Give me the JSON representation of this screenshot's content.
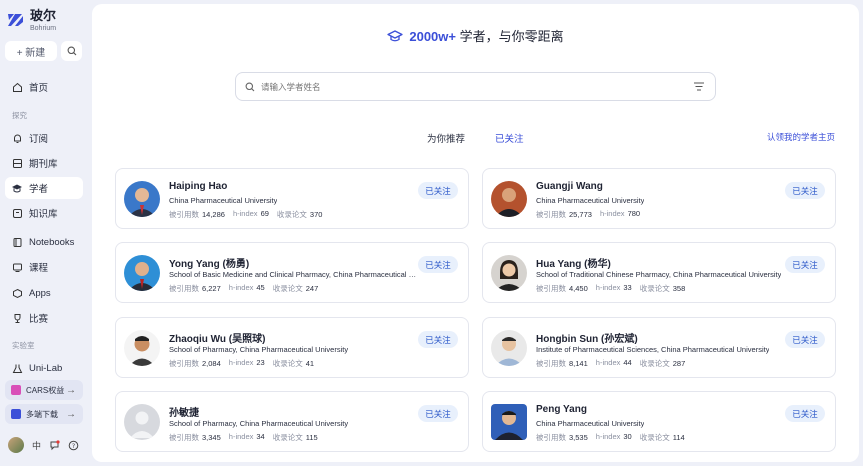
{
  "brand": {
    "name_cn": "玻尔",
    "name_en": "Bohrium"
  },
  "sidebar": {
    "new_label": "+ 新建",
    "items": [
      {
        "label": "首页",
        "icon": "home-icon"
      },
      {
        "label": "订阅",
        "icon": "bell-icon"
      },
      {
        "label": "期刊库",
        "icon": "journal-icon"
      },
      {
        "label": "学者",
        "icon": "scholar-icon"
      },
      {
        "label": "知识库",
        "icon": "knowledge-icon"
      },
      {
        "label": "Notebooks",
        "icon": "notebook-icon"
      },
      {
        "label": "课程",
        "icon": "course-icon"
      },
      {
        "label": "Apps",
        "icon": "apps-icon"
      },
      {
        "label": "比赛",
        "icon": "trophy-icon"
      },
      {
        "label": "Uni-Lab",
        "icon": "lab-icon"
      }
    ],
    "section_explore": "探究",
    "section_lab": "实验室",
    "promo_cards": "CARS权益",
    "promo_download": "多端下载",
    "lang": "中"
  },
  "header": {
    "count": "2000w+",
    "text": "学者，与你零距离"
  },
  "search": {
    "placeholder": "请输入学者姓名"
  },
  "tabs": [
    {
      "label": "为你推荐"
    },
    {
      "label": "已关注"
    }
  ],
  "claim_link": "认领我的学者主页",
  "labels": {
    "citations": "被引用数",
    "hindex": "h-index",
    "papers": "收录论文"
  },
  "scholars": [
    {
      "name": "Haiping Hao",
      "inst": "China Pharmaceutical University",
      "citations": "14,286",
      "hindex": "69",
      "papers": "370",
      "follow": "已关注"
    },
    {
      "name": "Guangji Wang",
      "inst": "China Pharmaceutical University",
      "citations": "25,773",
      "hindex": "780",
      "papers": "",
      "follow": "已关注"
    },
    {
      "name": "Yong Yang (杨勇)",
      "inst": "School of Basic Medicine and Clinical Pharmacy, China Pharmaceutical University",
      "citations": "6,227",
      "hindex": "45",
      "papers": "247",
      "follow": "已关注"
    },
    {
      "name": "Hua Yang (杨华)",
      "inst": "School of Traditional Chinese Pharmacy, China Pharmaceutical University",
      "citations": "4,450",
      "hindex": "33",
      "papers": "358",
      "follow": "已关注"
    },
    {
      "name": "Zhaoqiu Wu (吴照球)",
      "inst": "School of Pharmacy, China Pharmaceutical University",
      "citations": "2,084",
      "hindex": "23",
      "papers": "41",
      "follow": "已关注"
    },
    {
      "name": "Hongbin Sun (孙宏斌)",
      "inst": "Institute of Pharmaceutical Sciences, China Pharmaceutical University",
      "citations": "8,141",
      "hindex": "44",
      "papers": "287",
      "follow": "已关注"
    },
    {
      "name": "孙敏捷",
      "inst": "School of Pharmacy, China Pharmaceutical University",
      "citations": "3,345",
      "hindex": "34",
      "papers": "115",
      "follow": "已关注"
    },
    {
      "name": "Peng Yang",
      "inst": "China Pharmaceutical University",
      "citations": "3,535",
      "hindex": "30",
      "papers": "114",
      "follow": "已关注"
    }
  ]
}
